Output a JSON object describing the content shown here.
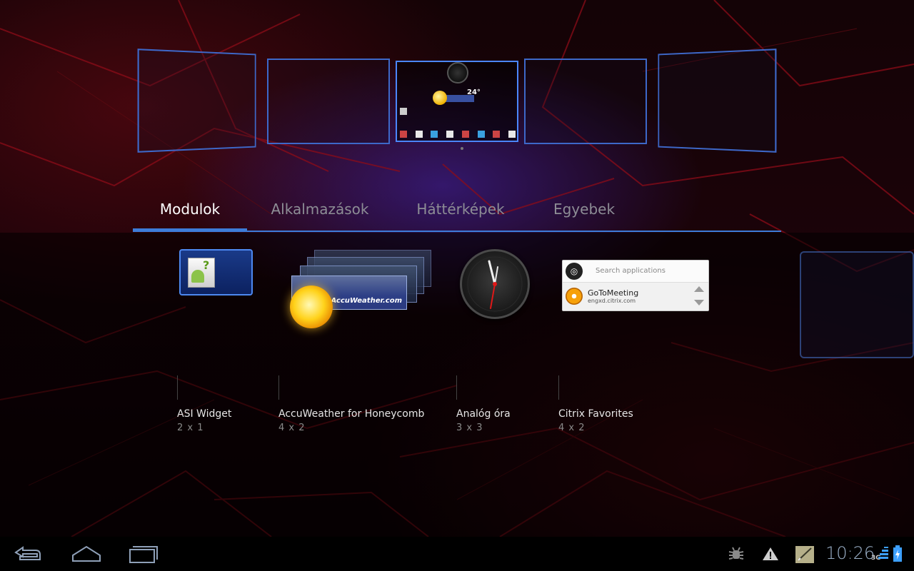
{
  "workspace": {
    "current_screen_weather_temp": "24°"
  },
  "tabs": [
    {
      "label": "Modulok",
      "active": true
    },
    {
      "label": "Alkalmazások",
      "active": false
    },
    {
      "label": "Háttérképek",
      "active": false
    },
    {
      "label": "Egyebek",
      "active": false
    }
  ],
  "widgets": [
    {
      "name": "ASI Widget",
      "size": "2 x 1"
    },
    {
      "name": "AccuWeather for Honeycomb",
      "size": "4 x 2",
      "preview_brand": "AccuWeather.com"
    },
    {
      "name": "Analóg óra",
      "size": "3 x 3"
    },
    {
      "name": "Citrix Favorites",
      "size": "4 x 2",
      "preview": {
        "search_placeholder": "Search applications",
        "app_name": "GoToMeeting",
        "app_host": "engxd.citrix.com"
      }
    }
  ],
  "system_bar": {
    "time": "10:26",
    "network": "3G",
    "icons": [
      "back-icon",
      "home-icon",
      "recent-apps-icon",
      "usb-debugging-icon",
      "warning-icon",
      "notes-icon",
      "signal-icon",
      "battery-charging-icon"
    ]
  },
  "colors": {
    "accent": "#3d7cd8",
    "clock_text": "#9bb0c8"
  }
}
